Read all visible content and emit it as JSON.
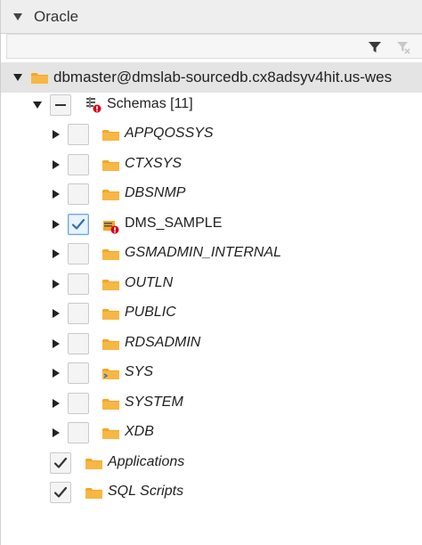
{
  "panel": {
    "title": "Oracle"
  },
  "toolbar": {
    "filter_icon": "filter-icon",
    "clear_filter_icon": "clear-filter-icon"
  },
  "connection": {
    "label": "dbmaster@dmslab-sourcedb.cx8adsyv4hit.us-wes"
  },
  "schemas_node": {
    "label": "Schemas [11]",
    "check_state": "indeterminate",
    "icon": "schemas-error-icon"
  },
  "schemas": [
    {
      "name": "APPQOSSYS",
      "checked": false,
      "italic": true,
      "icon": "folder-icon"
    },
    {
      "name": "CTXSYS",
      "checked": false,
      "italic": true,
      "icon": "folder-icon"
    },
    {
      "name": "DBSNMP",
      "checked": false,
      "italic": true,
      "icon": "folder-icon"
    },
    {
      "name": "DMS_SAMPLE",
      "checked": true,
      "italic": false,
      "icon": "schema-error-icon"
    },
    {
      "name": "GSMADMIN_INTERNAL",
      "checked": false,
      "italic": true,
      "icon": "folder-icon"
    },
    {
      "name": "OUTLN",
      "checked": false,
      "italic": true,
      "icon": "folder-icon"
    },
    {
      "name": "PUBLIC",
      "checked": false,
      "italic": true,
      "icon": "folder-icon"
    },
    {
      "name": "RDSADMIN",
      "checked": false,
      "italic": true,
      "icon": "folder-icon"
    },
    {
      "name": "SYS",
      "checked": false,
      "italic": true,
      "icon": "schema-folder-icon"
    },
    {
      "name": "SYSTEM",
      "checked": false,
      "italic": true,
      "icon": "folder-icon"
    },
    {
      "name": "XDB",
      "checked": false,
      "italic": true,
      "icon": "folder-icon"
    }
  ],
  "extras": [
    {
      "name": "Applications",
      "checked": true,
      "italic": true,
      "icon": "folder-icon"
    },
    {
      "name": "SQL Scripts",
      "checked": true,
      "italic": true,
      "icon": "folder-icon"
    }
  ],
  "colors": {
    "folder": "#f5a623",
    "error_badge": "#d0021b",
    "check_blue": "#2f6fb5"
  }
}
